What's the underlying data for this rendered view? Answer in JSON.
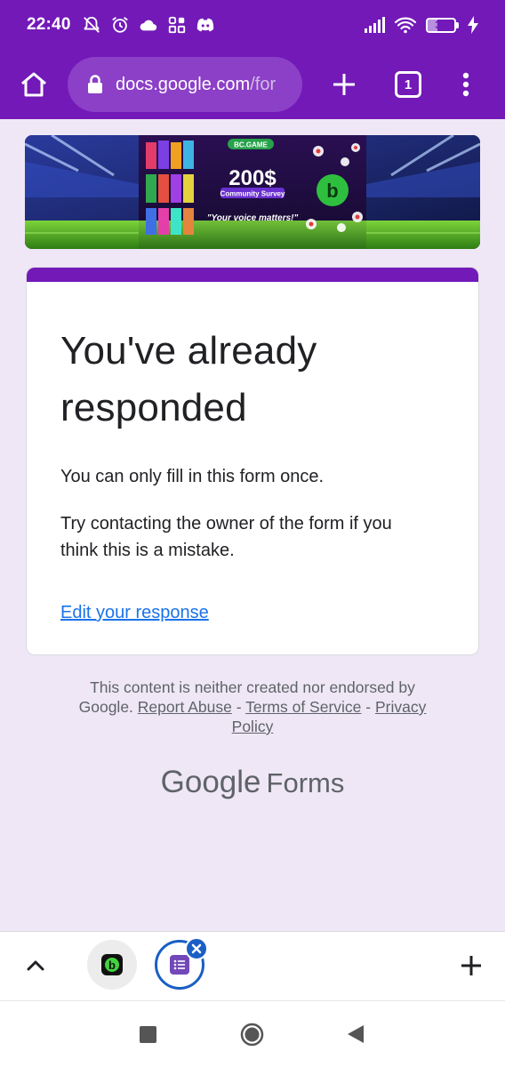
{
  "status_bar": {
    "time": "22:40",
    "battery_level": "36",
    "battery_fraction": 0.36,
    "icons": [
      "mute-notifications-icon",
      "alarm-icon",
      "cloud-icon",
      "grid-app-icon",
      "discord-icon",
      "signal-icon",
      "wifi-icon",
      "battery-icon",
      "charging-icon"
    ]
  },
  "browser": {
    "url_host": "docs.google.com",
    "url_path": "/for",
    "tab_count": "1",
    "icons": [
      "home-icon",
      "lock-icon",
      "plus-icon",
      "tab-switcher-icon",
      "more-vert-icon"
    ]
  },
  "banner": {
    "brand": "BC.GAME",
    "amount": "200$",
    "subtitle": "Community Survey",
    "tagline": "\"Your voice matters!\""
  },
  "form": {
    "accent_color": "#7219b8",
    "title_line1": "You've already",
    "title_line2": "responded",
    "message1": "You can only fill in this form once.",
    "message2_line1": "Try contacting the owner of the form if you",
    "message2_line2": "think this is a mistake.",
    "edit_link": "Edit your response"
  },
  "footer": {
    "disclaimer_line1": "This content is neither created nor endorsed by",
    "google": "Google.",
    "report_abuse": "Report Abuse",
    "sep": "-",
    "terms": "Terms of Service",
    "privacy_1": "Privacy",
    "privacy_2": "Policy",
    "logo_google": "Google",
    "logo_forms": "Forms"
  },
  "tab_group": {
    "icons": [
      "chevron-up-icon",
      "bcgame-tab-icon",
      "forms-tab-icon",
      "close-icon",
      "plus-icon"
    ]
  },
  "nav_bar": {
    "icons": [
      "recents-icon",
      "home-icon",
      "back-icon"
    ]
  }
}
